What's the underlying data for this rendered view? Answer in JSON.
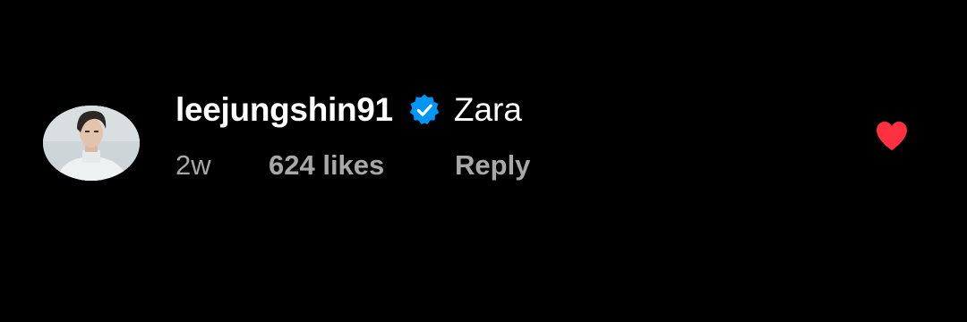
{
  "comment": {
    "username": "leejungshin91",
    "verified": true,
    "text": "Zara",
    "time": "2w",
    "likes": "624 likes",
    "reply_label": "Reply",
    "liked": true
  },
  "icons": {
    "verified": "verified-badge-icon",
    "like": "heart-icon"
  },
  "colors": {
    "background": "#000000",
    "verified_badge": "#0095f6",
    "heart": "#ff3040",
    "meta_text": "#a8a8a8"
  }
}
